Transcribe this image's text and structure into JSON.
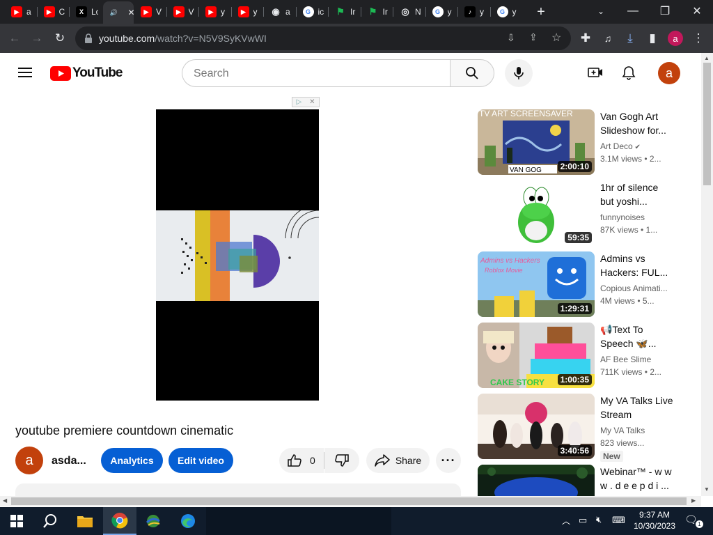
{
  "browser": {
    "tabs": [
      {
        "letter": "a",
        "color": "#ff0000",
        "glyph": "▶"
      },
      {
        "letter": "C",
        "color": "#ff0000",
        "glyph": "▶"
      },
      {
        "letter": "Lo",
        "color": "#000000",
        "glyph": "X"
      },
      {
        "letter": "",
        "color": "#35363a",
        "glyph": "🔊"
      },
      {
        "letter": "V",
        "color": "#ff0000",
        "glyph": "▶"
      },
      {
        "letter": "V",
        "color": "#ff0000",
        "glyph": "▶"
      },
      {
        "letter": "y",
        "color": "#ff0000",
        "glyph": "▶"
      },
      {
        "letter": "y",
        "color": "#ff0000",
        "glyph": "▶"
      },
      {
        "letter": "a",
        "color": "#5f6368",
        "glyph": "◉"
      },
      {
        "letter": "ic",
        "color": "#ffffff",
        "glyph": "G"
      },
      {
        "letter": "Ir",
        "color": "#0f9d58",
        "glyph": "⚑"
      },
      {
        "letter": "Ir",
        "color": "#0f9d58",
        "glyph": "⚑"
      },
      {
        "letter": "N",
        "color": "#5f6368",
        "glyph": "◎"
      },
      {
        "letter": "y",
        "color": "#ffffff",
        "glyph": "G"
      },
      {
        "letter": "y",
        "color": "#000000",
        "glyph": "♪"
      },
      {
        "letter": "y",
        "color": "#ffffff",
        "glyph": "G"
      }
    ],
    "url_domain": "youtube.com",
    "url_path": "/watch?v=N5V9SyKVwWI"
  },
  "youtube": {
    "logo_text": "YouTube",
    "search_placeholder": "Search",
    "avatar_letter": "a",
    "video_title": "youtube premiere countdown cinematic",
    "channel_name": "asda...",
    "analytics_label": "Analytics",
    "edit_video_label": "Edit video",
    "like_count": "0",
    "share_label": "Share",
    "recommendations": [
      {
        "title": "Van Gogh Art Slideshow for...",
        "channel": "Art Deco",
        "meta": "3.1M views • 2...",
        "duration": "2:00:10",
        "thumb_text_top": "TV ART SCREENSAVER",
        "thumb_text_bottom": "VAN GOG",
        "badge": ""
      },
      {
        "title": "1hr of silence but yoshi...",
        "channel": "funnynoises",
        "meta": "87K views • 1...",
        "duration": "59:35",
        "badge": ""
      },
      {
        "title": "Admins vs Hackers: FUL...",
        "channel": "Copious Animati...",
        "meta": "4M views • 5...",
        "duration": "1:29:31",
        "thumb_text_top": "Admins vs Hackers",
        "thumb_text_bottom": "Roblox Movie",
        "badge": ""
      },
      {
        "title": "📢Text To Speech 🦋...",
        "channel": "AF Bee Slime",
        "meta": "711K views • 2...",
        "duration": "1:00:35",
        "thumb_text_bottom": "CAKE STORY",
        "badge": ""
      },
      {
        "title": "My VA Talks Live Stream",
        "channel": "My VA Talks",
        "meta": "823 views...",
        "duration": "3:40:56",
        "badge": "New"
      },
      {
        "title": "Webinar™ - w w w . d e e p d i ...",
        "channel": "",
        "meta": "",
        "duration": "",
        "badge": ""
      }
    ]
  },
  "taskbar": {
    "time": "9:37 AM",
    "date": "10/30/2023"
  }
}
